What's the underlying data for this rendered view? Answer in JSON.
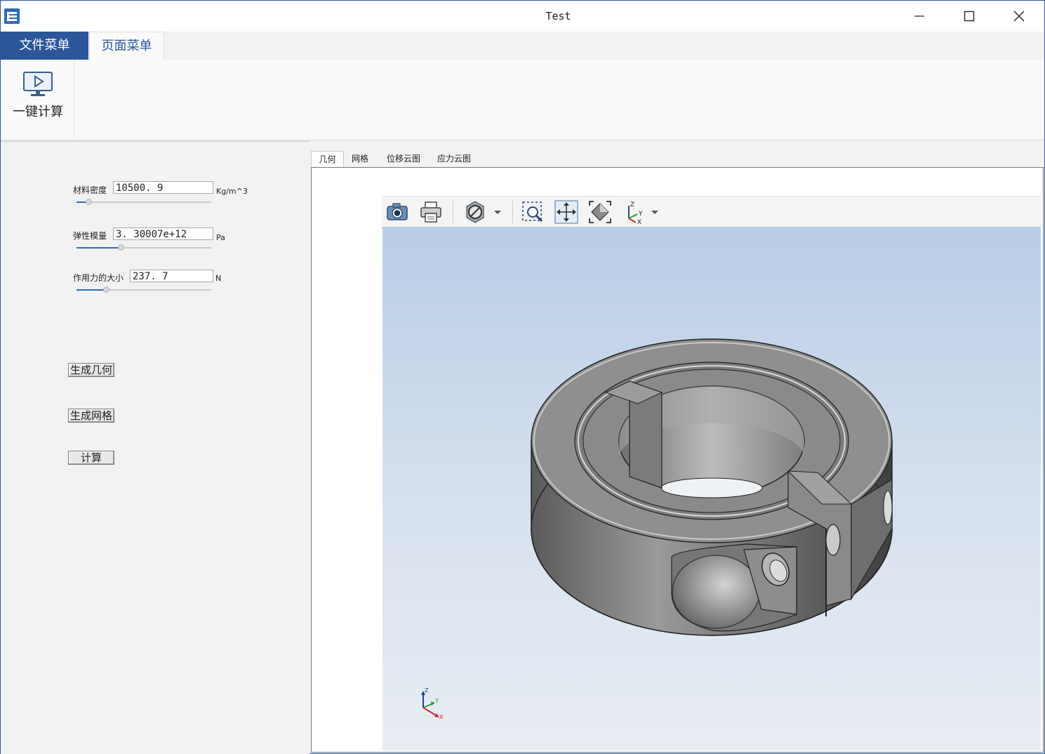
{
  "window": {
    "title": "Test"
  },
  "ribbon": {
    "tabs": [
      {
        "label": "文件菜单"
      },
      {
        "label": "页面菜单"
      }
    ],
    "buttons": {
      "compute_all_label": "一键计算"
    }
  },
  "params": {
    "density": {
      "label": "材料密度",
      "value": "10500. 9",
      "unit": "Kg/m^3",
      "slider_fraction": 0.09
    },
    "modulus": {
      "label": "弹性模量",
      "value": "3. 30007e+12",
      "unit": "Pa",
      "slider_fraction": 0.33
    },
    "force": {
      "label": "作用力的大小",
      "value": "237. 7",
      "unit": "N",
      "slider_fraction": 0.22
    }
  },
  "actions": {
    "gen_geometry": "生成几何",
    "gen_mesh": "生成网格",
    "compute": "计算"
  },
  "viewer": {
    "tabs": [
      {
        "label": "几何"
      },
      {
        "label": "网格"
      },
      {
        "label": "位移云图"
      },
      {
        "label": "应力云图"
      }
    ],
    "toolbar": [
      "camera-icon",
      "print-icon",
      "no-selection-icon",
      "zoom-box-icon",
      "pan-icon",
      "fit-all-icon",
      "axis-orientation-icon"
    ],
    "axis_labels": {
      "x": "X",
      "y": "Y",
      "z": "Z"
    }
  },
  "colors": {
    "accent": "#2b579a",
    "slider_fill": "#2b6cb5"
  }
}
